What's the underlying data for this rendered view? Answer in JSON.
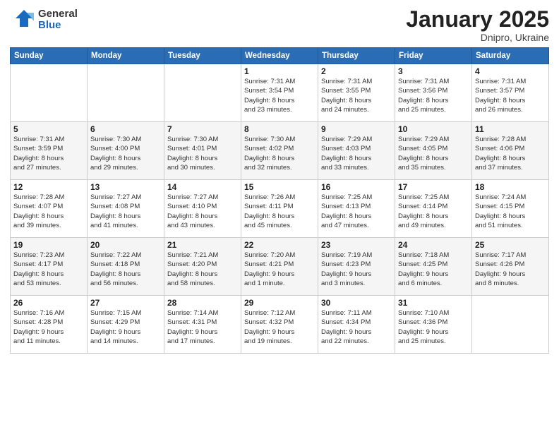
{
  "header": {
    "logo_general": "General",
    "logo_blue": "Blue",
    "title": "January 2025",
    "location": "Dnipro, Ukraine"
  },
  "weekdays": [
    "Sunday",
    "Monday",
    "Tuesday",
    "Wednesday",
    "Thursday",
    "Friday",
    "Saturday"
  ],
  "weeks": [
    [
      {
        "day": "",
        "info": ""
      },
      {
        "day": "",
        "info": ""
      },
      {
        "day": "",
        "info": ""
      },
      {
        "day": "1",
        "info": "Sunrise: 7:31 AM\nSunset: 3:54 PM\nDaylight: 8 hours\nand 23 minutes."
      },
      {
        "day": "2",
        "info": "Sunrise: 7:31 AM\nSunset: 3:55 PM\nDaylight: 8 hours\nand 24 minutes."
      },
      {
        "day": "3",
        "info": "Sunrise: 7:31 AM\nSunset: 3:56 PM\nDaylight: 8 hours\nand 25 minutes."
      },
      {
        "day": "4",
        "info": "Sunrise: 7:31 AM\nSunset: 3:57 PM\nDaylight: 8 hours\nand 26 minutes."
      }
    ],
    [
      {
        "day": "5",
        "info": "Sunrise: 7:31 AM\nSunset: 3:59 PM\nDaylight: 8 hours\nand 27 minutes."
      },
      {
        "day": "6",
        "info": "Sunrise: 7:30 AM\nSunset: 4:00 PM\nDaylight: 8 hours\nand 29 minutes."
      },
      {
        "day": "7",
        "info": "Sunrise: 7:30 AM\nSunset: 4:01 PM\nDaylight: 8 hours\nand 30 minutes."
      },
      {
        "day": "8",
        "info": "Sunrise: 7:30 AM\nSunset: 4:02 PM\nDaylight: 8 hours\nand 32 minutes."
      },
      {
        "day": "9",
        "info": "Sunrise: 7:29 AM\nSunset: 4:03 PM\nDaylight: 8 hours\nand 33 minutes."
      },
      {
        "day": "10",
        "info": "Sunrise: 7:29 AM\nSunset: 4:05 PM\nDaylight: 8 hours\nand 35 minutes."
      },
      {
        "day": "11",
        "info": "Sunrise: 7:28 AM\nSunset: 4:06 PM\nDaylight: 8 hours\nand 37 minutes."
      }
    ],
    [
      {
        "day": "12",
        "info": "Sunrise: 7:28 AM\nSunset: 4:07 PM\nDaylight: 8 hours\nand 39 minutes."
      },
      {
        "day": "13",
        "info": "Sunrise: 7:27 AM\nSunset: 4:08 PM\nDaylight: 8 hours\nand 41 minutes."
      },
      {
        "day": "14",
        "info": "Sunrise: 7:27 AM\nSunset: 4:10 PM\nDaylight: 8 hours\nand 43 minutes."
      },
      {
        "day": "15",
        "info": "Sunrise: 7:26 AM\nSunset: 4:11 PM\nDaylight: 8 hours\nand 45 minutes."
      },
      {
        "day": "16",
        "info": "Sunrise: 7:25 AM\nSunset: 4:13 PM\nDaylight: 8 hours\nand 47 minutes."
      },
      {
        "day": "17",
        "info": "Sunrise: 7:25 AM\nSunset: 4:14 PM\nDaylight: 8 hours\nand 49 minutes."
      },
      {
        "day": "18",
        "info": "Sunrise: 7:24 AM\nSunset: 4:15 PM\nDaylight: 8 hours\nand 51 minutes."
      }
    ],
    [
      {
        "day": "19",
        "info": "Sunrise: 7:23 AM\nSunset: 4:17 PM\nDaylight: 8 hours\nand 53 minutes."
      },
      {
        "day": "20",
        "info": "Sunrise: 7:22 AM\nSunset: 4:18 PM\nDaylight: 8 hours\nand 56 minutes."
      },
      {
        "day": "21",
        "info": "Sunrise: 7:21 AM\nSunset: 4:20 PM\nDaylight: 8 hours\nand 58 minutes."
      },
      {
        "day": "22",
        "info": "Sunrise: 7:20 AM\nSunset: 4:21 PM\nDaylight: 9 hours\nand 1 minute."
      },
      {
        "day": "23",
        "info": "Sunrise: 7:19 AM\nSunset: 4:23 PM\nDaylight: 9 hours\nand 3 minutes."
      },
      {
        "day": "24",
        "info": "Sunrise: 7:18 AM\nSunset: 4:25 PM\nDaylight: 9 hours\nand 6 minutes."
      },
      {
        "day": "25",
        "info": "Sunrise: 7:17 AM\nSunset: 4:26 PM\nDaylight: 9 hours\nand 8 minutes."
      }
    ],
    [
      {
        "day": "26",
        "info": "Sunrise: 7:16 AM\nSunset: 4:28 PM\nDaylight: 9 hours\nand 11 minutes."
      },
      {
        "day": "27",
        "info": "Sunrise: 7:15 AM\nSunset: 4:29 PM\nDaylight: 9 hours\nand 14 minutes."
      },
      {
        "day": "28",
        "info": "Sunrise: 7:14 AM\nSunset: 4:31 PM\nDaylight: 9 hours\nand 17 minutes."
      },
      {
        "day": "29",
        "info": "Sunrise: 7:12 AM\nSunset: 4:32 PM\nDaylight: 9 hours\nand 19 minutes."
      },
      {
        "day": "30",
        "info": "Sunrise: 7:11 AM\nSunset: 4:34 PM\nDaylight: 9 hours\nand 22 minutes."
      },
      {
        "day": "31",
        "info": "Sunrise: 7:10 AM\nSunset: 4:36 PM\nDaylight: 9 hours\nand 25 minutes."
      },
      {
        "day": "",
        "info": ""
      }
    ]
  ]
}
